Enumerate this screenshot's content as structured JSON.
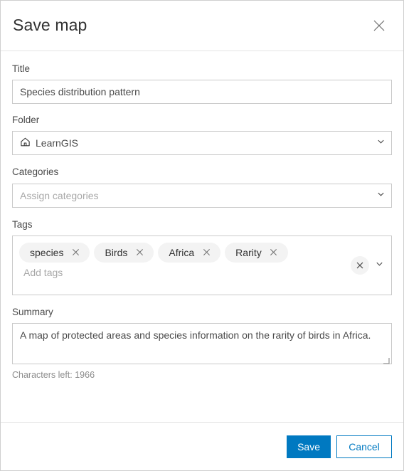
{
  "dialog": {
    "title": "Save map",
    "close_icon": "close-icon"
  },
  "form": {
    "title_field": {
      "label": "Title",
      "value": "Species distribution pattern",
      "placeholder": "Title"
    },
    "folder_field": {
      "label": "Folder",
      "value": "LearnGIS",
      "icon": "home-icon",
      "chevron": "chevron-down-icon"
    },
    "categories_field": {
      "label": "Categories",
      "value": "",
      "placeholder": "Assign categories",
      "chevron": "chevron-down-icon"
    },
    "tags_field": {
      "label": "Tags",
      "placeholder": "Add tags",
      "value": "",
      "tags": [
        {
          "label": "species",
          "remove_icon": "close-icon"
        },
        {
          "label": "Birds",
          "remove_icon": "close-icon"
        },
        {
          "label": "Africa",
          "remove_icon": "close-icon"
        },
        {
          "label": "Rarity",
          "remove_icon": "close-icon"
        }
      ],
      "clear_icon": "close-icon",
      "chevron": "chevron-down-icon"
    },
    "summary_field": {
      "label": "Summary",
      "value": "A map of protected areas and species information on the rarity of birds in Africa.",
      "characters_left": "Characters left: 1966"
    }
  },
  "footer": {
    "save_label": "Save",
    "cancel_label": "Cancel"
  },
  "colors": {
    "accent": "#0079c1",
    "text": "#4a4a4a",
    "title": "#323232",
    "border": "#cacaca",
    "chip_bg": "#f3f3f3",
    "placeholder": "#a8a8a8"
  }
}
